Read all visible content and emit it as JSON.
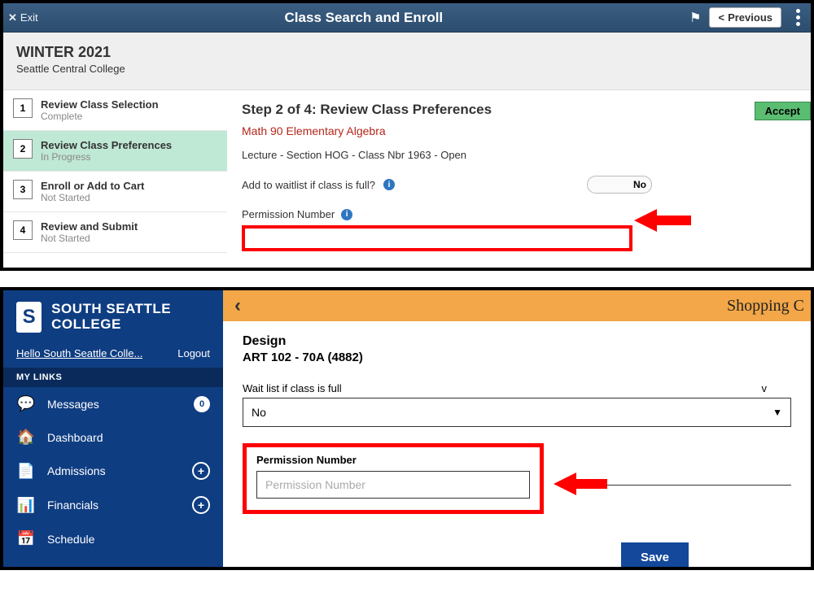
{
  "top": {
    "exit_label": "Exit",
    "page_title": "Class Search and Enroll",
    "previous_label": "Previous",
    "term": "WINTER 2021",
    "college": "Seattle Central College",
    "steps": [
      {
        "num": "1",
        "title": "Review Class Selection",
        "sub": "Complete"
      },
      {
        "num": "2",
        "title": "Review Class Preferences",
        "sub": "In Progress"
      },
      {
        "num": "3",
        "title": "Enroll or Add to Cart",
        "sub": "Not Started"
      },
      {
        "num": "4",
        "title": "Review and Submit",
        "sub": "Not Started"
      }
    ],
    "accept_label": "Accept",
    "step_heading": "Step 2 of 4: Review Class Preferences",
    "course_line": "Math 90  Elementary Algebra",
    "lecture_line": "Lecture - Section HOG - Class Nbr 1963 - Open",
    "waitlist_label": "Add to waitlist if class is full?",
    "waitlist_value": "No",
    "permission_label": "Permission Number"
  },
  "bottom": {
    "brand": "SOUTH SEATTLE COLLEGE",
    "greeting": "Hello South Seattle Colle...",
    "logout_label": "Logout",
    "mylinks_header": "MY LINKS",
    "nav": {
      "messages": {
        "label": "Messages",
        "badge": "0"
      },
      "dashboard": {
        "label": "Dashboard"
      },
      "admissions": {
        "label": "Admissions"
      },
      "financials": {
        "label": "Financials"
      },
      "schedule": {
        "label": "Schedule"
      }
    },
    "shop_title": "Shopping C",
    "course_title": "Design",
    "course_code": "ART 102 - 70A (4882)",
    "waitlist_label": "Wait list if class is full",
    "waitlist_marker": "v",
    "waitlist_value": "No",
    "permission_label": "Permission Number",
    "permission_placeholder": "Permission Number",
    "save_label": "Save"
  }
}
